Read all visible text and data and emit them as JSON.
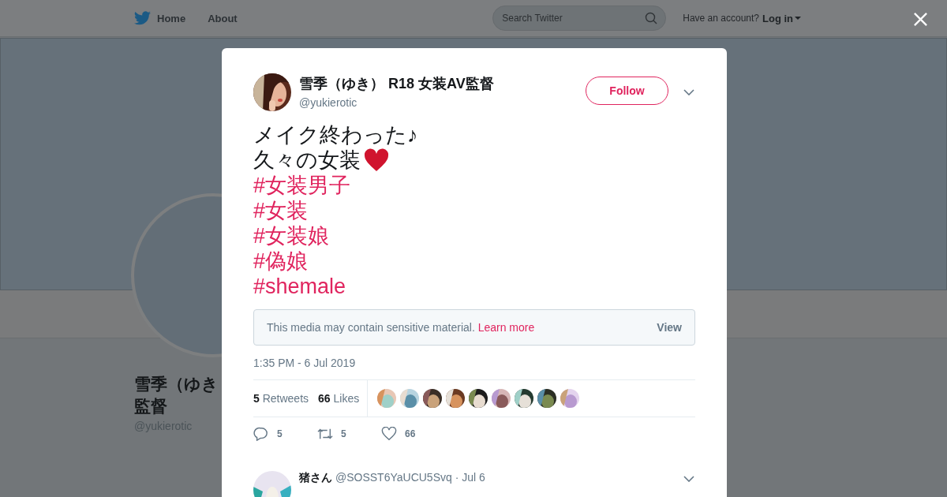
{
  "nav": {
    "items": [
      {
        "label": "Home"
      },
      {
        "label": "About"
      }
    ],
    "search": {
      "placeholder": "Search Twitter"
    },
    "account_prompt": "Have an account?",
    "login": "Log in"
  },
  "profile": {
    "name_lines": [
      "雪季（ゆき",
      "監督"
    ],
    "handle": "@yukierotic"
  },
  "tweet": {
    "author": {
      "name": "雪季（ゆき） R18 女装AV監督",
      "handle": "@yukierotic"
    },
    "follow_button": "Follow",
    "lines": [
      {
        "kind": "text",
        "text": "メイク終わった♪",
        "heart_emoji": false
      },
      {
        "kind": "text",
        "text": "久々の女装",
        "heart_emoji": true
      },
      {
        "kind": "hashtag",
        "text": "#女装男子",
        "heart_emoji": false
      },
      {
        "kind": "hashtag",
        "text": "#女装",
        "heart_emoji": false
      },
      {
        "kind": "hashtag",
        "text": "#女装娘",
        "heart_emoji": false
      },
      {
        "kind": "hashtag",
        "text": "#偽娘",
        "heart_emoji": false
      },
      {
        "kind": "hashtag",
        "text": "#shemale",
        "heart_emoji": false
      }
    ],
    "sensitive_notice": {
      "text": "This media may contain sensitive material.",
      "link": "Learn more",
      "button": "View"
    },
    "timestamp": "1:35 PM - 6 Jul 2019",
    "stats": [
      {
        "count": "5",
        "label": "Retweets"
      },
      {
        "count": "66",
        "label": "Likes"
      }
    ],
    "actions": [
      {
        "kind": "reply",
        "count": "5"
      },
      {
        "kind": "retweet",
        "count": "5"
      },
      {
        "kind": "like",
        "count": "66"
      }
    ]
  },
  "reply": {
    "name": "猪さん",
    "handle": "@SOSST6YaUCU5Svq",
    "date": "· Jul 6"
  }
}
